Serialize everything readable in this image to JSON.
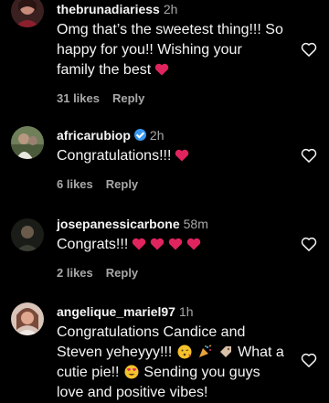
{
  "comments": [
    {
      "username": "thebrunadiariess",
      "time": "2h",
      "text_lines": [
        "Omg that’s the sweetest thing!!! So",
        "happy for you!! Wishing your",
        "family the best"
      ],
      "likes": "31 likes",
      "reply": "Reply",
      "avatar_color": "#6b3a3a"
    },
    {
      "username": "africarubiop",
      "time": "2h",
      "verified": true,
      "text": "Congratulations!!!",
      "likes": "6 likes",
      "reply": "Reply",
      "avatar_color": "#5a6b4a"
    },
    {
      "username": "josepanessicarbone",
      "time": "58m",
      "text": "Congrats!!!",
      "likes": "2 likes",
      "reply": "Reply",
      "avatar_color": "#2a2e28"
    },
    {
      "username": "angelique_mariel97",
      "time": "1h",
      "text_line1": "Congratulations Candice and",
      "text_line2a": "Steven yeheyyy!!!",
      "text_line2b": "What a",
      "text_line3a": "cutie pie!!",
      "text_line3b": "Sending you guys",
      "text_line4": "love and positive vibes!",
      "avatar_color": "#c98f7a"
    }
  ],
  "colors": {
    "background": "#000000",
    "text": "#f5f5f5",
    "muted": "#a8a8a8",
    "heart": "#e0245e",
    "verified": "#3897f0"
  },
  "icons": [
    "heart-outline-icon",
    "red-heart-emoji",
    "verified-badge-icon",
    "face-blowing-kiss-emoji",
    "party-popper-emoji",
    "label-tag-emoji",
    "smiling-heart-eyes-emoji"
  ]
}
